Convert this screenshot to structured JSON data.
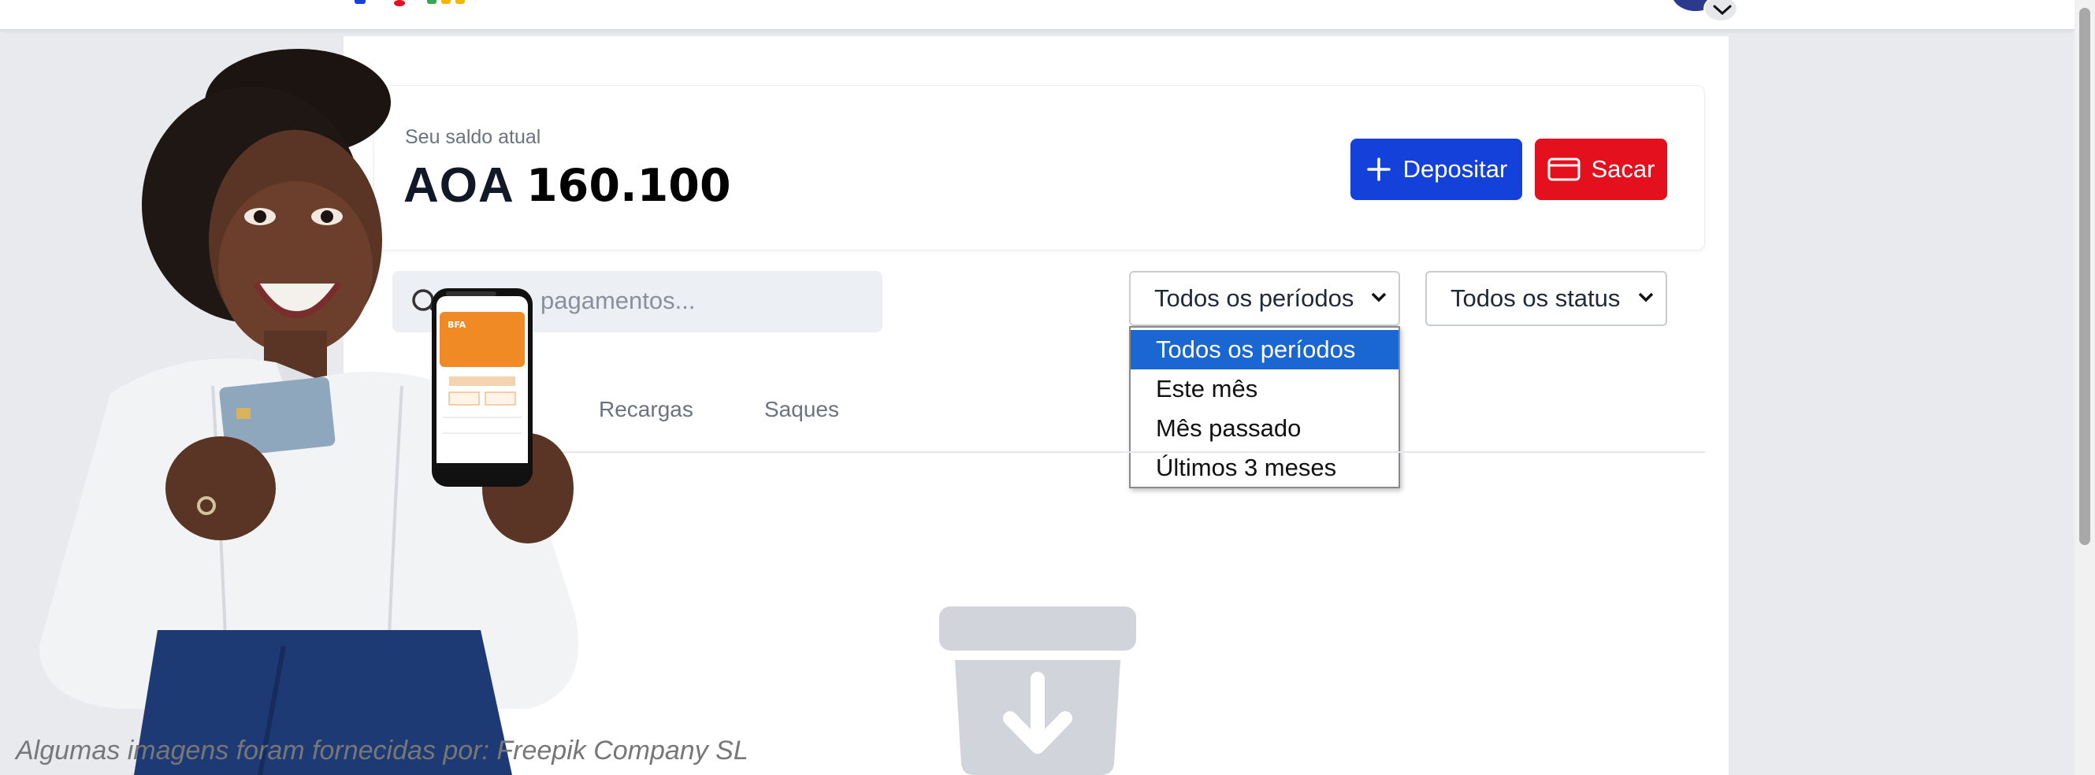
{
  "header": {
    "logo_colors": [
      "#1441d9",
      "#e4101d",
      "#f7b500",
      "#34a853",
      "#f7b500"
    ],
    "avatar_color": "#2b3a8c",
    "avatar_chevron_icon": "chevron-down-icon"
  },
  "balance": {
    "label": "Seu saldo atual",
    "currency": "AOA",
    "amount": "160.100"
  },
  "actions": {
    "deposit_label": "Depositar",
    "deposit_icon": "plus-icon",
    "deposit_color": "#1441d9",
    "withdraw_label": "Sacar",
    "withdraw_icon": "credit-card-icon",
    "withdraw_color": "#e4101d"
  },
  "search": {
    "placeholder_visible": "pagamentos..."
  },
  "filters": {
    "period": {
      "selected": "Todos os períodos",
      "options": [
        "Todos os períodos",
        "Este mês",
        "Mês passado",
        "Últimos 3 meses"
      ],
      "highlight_color": "#1a66d2"
    },
    "status": {
      "selected": "Todos os status"
    }
  },
  "tabs": [
    "Recargas",
    "Saques"
  ],
  "empty_state": {
    "icon": "archive-download-icon"
  },
  "promo": {
    "image": "woman-holding-phone-and-card",
    "phone_screen_brand": "BFA"
  },
  "footer": {
    "credit": "Algumas imagens foram fornecidas por: Freepik Company SL"
  }
}
